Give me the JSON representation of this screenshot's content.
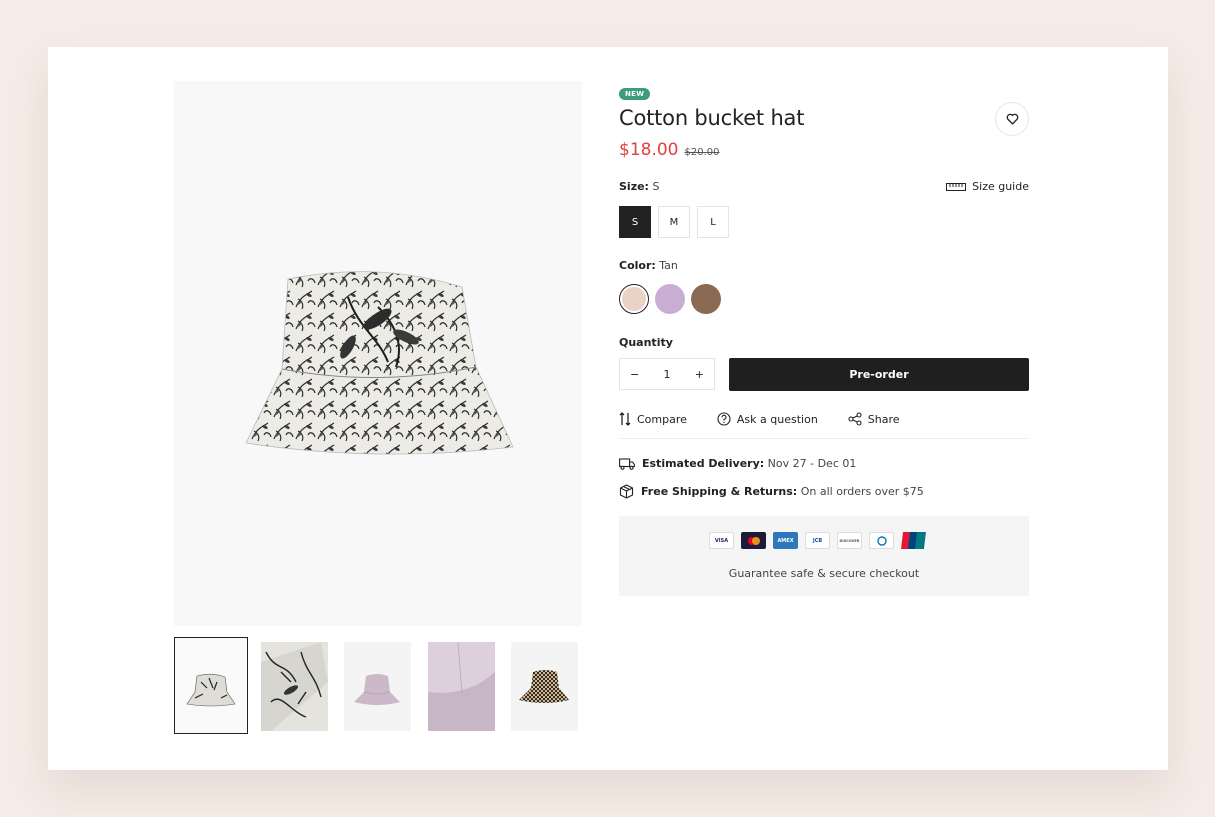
{
  "product": {
    "badge": "NEW",
    "title": "Cotton bucket hat",
    "price": "$18.00",
    "old_price": "$20.00"
  },
  "size": {
    "label": "Size:",
    "selected": "S",
    "guide_label": "Size guide",
    "options": [
      "S",
      "M",
      "L"
    ]
  },
  "color": {
    "label": "Color:",
    "selected": "Tan",
    "swatches": [
      "#ead3c4",
      "#c9aed4",
      "#8a6a52"
    ]
  },
  "quantity": {
    "label": "Quantity",
    "value": "1",
    "minus": "−",
    "plus": "+"
  },
  "preorder_label": "Pre-order",
  "actions": {
    "compare": "Compare",
    "ask": "Ask a question",
    "share": "Share"
  },
  "shipping": {
    "delivery_label": "Estimated Delivery:",
    "delivery_value": "Nov 27 - Dec 01",
    "free_label": "Free Shipping & Returns:",
    "free_value": "On all orders over $75"
  },
  "payment": {
    "cards": [
      "VISA",
      "Mastercard",
      "AMEX",
      "JCB",
      "DISCOVER",
      "Diners Club",
      "UnionPay"
    ],
    "visa_text": "VISA",
    "amex_text": "AMEX",
    "jcb_text": "JCB",
    "discover_text": "DISCOVER",
    "secure_text": "Guarantee safe & secure checkout"
  },
  "thumbnails": [
    "floral-hat",
    "floral-hat-detail",
    "lilac-hat",
    "lilac-hat-detail",
    "houndstooth-hat"
  ],
  "colors": {
    "accent_price": "#e0413f",
    "badge": "#3f9b7d",
    "button": "#1f1f1f"
  }
}
